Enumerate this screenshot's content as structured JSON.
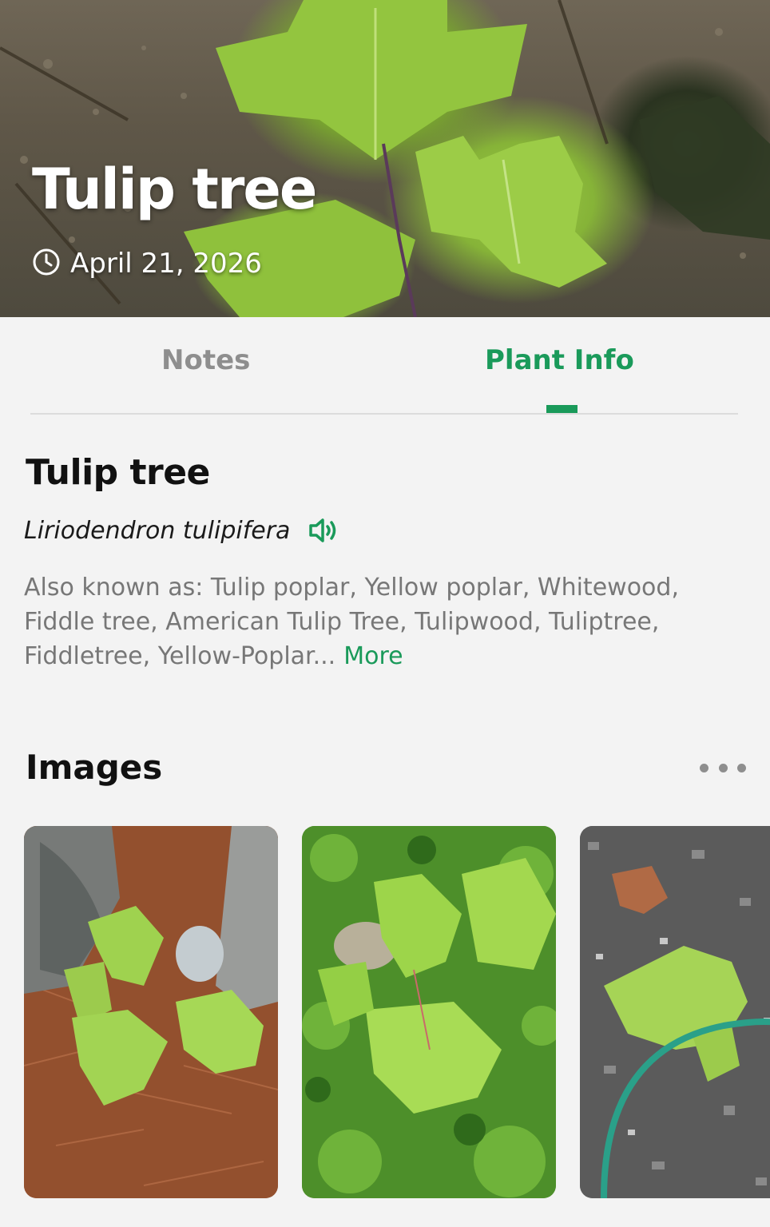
{
  "hero": {
    "title": "Tulip tree",
    "date": "April 21, 2026"
  },
  "tabs": [
    {
      "label": "Notes",
      "active": false
    },
    {
      "label": "Plant Info",
      "active": true
    }
  ],
  "plant": {
    "common_name": "Tulip tree",
    "scientific_name": "Liriodendron tulipifera",
    "also_known_as": "Also known as: Tulip poplar, Yellow poplar, Whitewood, Fiddle tree, American Tulip Tree, Tulipwood, Tuliptree, Fiddletree, Yellow-Poplar...",
    "more_label": "More"
  },
  "images_section": {
    "title": "Images"
  },
  "colors": {
    "accent": "#1a9a5a",
    "inactive_tab": "#8e8e8e",
    "text_primary": "#111111",
    "text_secondary": "#777777",
    "background": "#f3f3f3"
  },
  "icons": {
    "date": "clock-icon",
    "pronounce": "speaker-icon",
    "section_menu": "more-horizontal-icon"
  }
}
